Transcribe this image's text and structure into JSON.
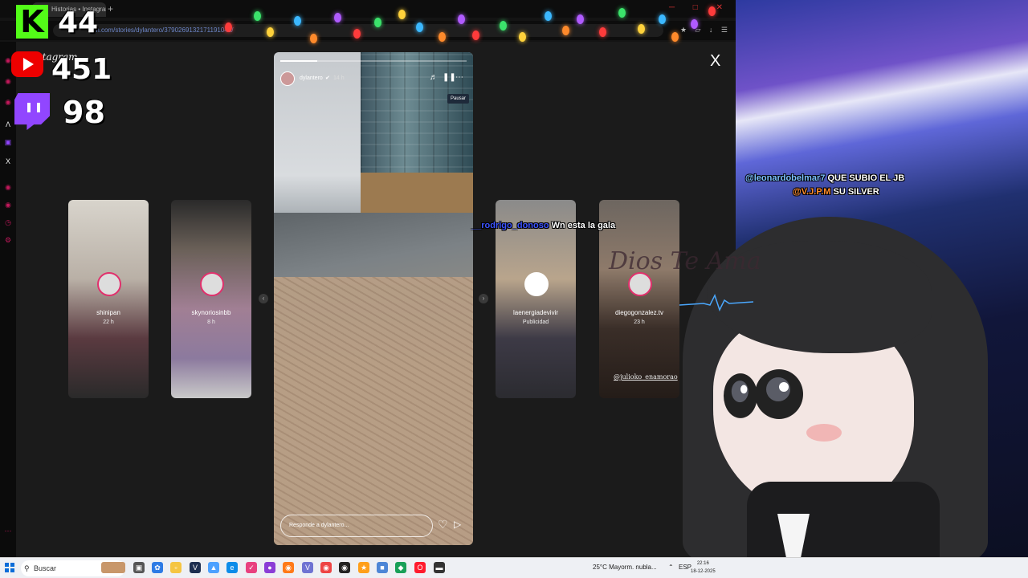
{
  "browser": {
    "tab_title": "Historias • Instagram",
    "url": "ram.com/stories/dylantero/3790269132171191046/",
    "logo_text": "Instagram",
    "close_label": "X"
  },
  "stats": {
    "kick_count": "44",
    "youtube_count": "451",
    "twitch_count": "98",
    "kick_letter": "K"
  },
  "story": {
    "username": "dylantero",
    "time": "14 h",
    "tooltip": "Pausar",
    "reply_placeholder": "Responde a dylantero...",
    "progress_fraction": 0.2
  },
  "side_stories": [
    {
      "username": "shinipan",
      "time": "22 h"
    },
    {
      "username": "skynoriosinbb",
      "time": "8 h"
    },
    {
      "username": "laenergiadevivir",
      "time": "Publicidad"
    },
    {
      "username": "diegogonzalez.tv",
      "time": "23 h",
      "credit": "@julioko_enamorao"
    }
  ],
  "chat": [
    {
      "user": "@leonardobelmar7",
      "message": "QUE SUBIO EL JB",
      "color": "#7cc3ff"
    },
    {
      "user": "@V.J.P.M",
      "message": "SU SILVER",
      "color": "#ff8c2a"
    },
    {
      "user": "__rodrigo_donoso",
      "message": "Wn esta la gala",
      "color": "#3b53ff"
    }
  ],
  "overlay_text": "Dios Te Ama",
  "taskbar": {
    "search_label": "Buscar",
    "weather": "25°C  Mayorm. nubla...",
    "lang": "ESP",
    "time": "22:16",
    "date": "18-12-2025"
  },
  "colors": {
    "kick": "#53fc18",
    "youtube": "#e00000",
    "twitch": "#9146ff",
    "instagram_ring": "#e1306c"
  }
}
